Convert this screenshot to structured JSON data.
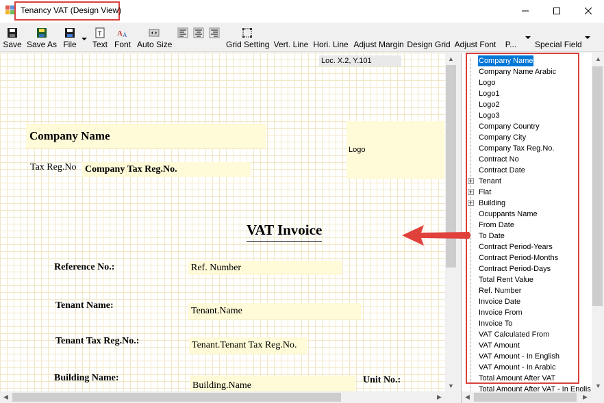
{
  "window": {
    "title": "Tenancy VAT (Design View)",
    "controls": [
      "minimize",
      "maximize",
      "close"
    ]
  },
  "toolbar": {
    "buttons": [
      {
        "label": "Save",
        "icon": "floppy-disk-icon"
      },
      {
        "label": "Save As",
        "icon": "save-as-icon"
      },
      {
        "label": "File",
        "icon": "file-floppy-icon"
      },
      {
        "label": "Text",
        "icon": "text-icon"
      },
      {
        "label": "Font",
        "icon": "font-icon"
      },
      {
        "label": "Auto Size",
        "icon": "auto-size-icon"
      },
      {
        "label": "Grid Setting",
        "icon": "grid-setting-icon"
      },
      {
        "label": "Vert. Line",
        "icon": ""
      },
      {
        "label": "Hori. Line",
        "icon": ""
      },
      {
        "label": "Adjust Margin",
        "icon": ""
      },
      {
        "label": "Design Grid",
        "icon": ""
      },
      {
        "label": "Adjust Font",
        "icon": ""
      },
      {
        "label": "P...",
        "icon": ""
      },
      {
        "label": "Special Field",
        "icon": ""
      }
    ]
  },
  "canvas": {
    "location_readout": "Loc. X.2, Y.101",
    "company_name": "Company Name",
    "logo": "Logo",
    "tax_reg_label": "Tax Reg.No",
    "company_tax_reg": "Company Tax Reg.No.",
    "invoice_title": "VAT Invoice",
    "reference_label": "Reference No.:",
    "reference_value": "Ref. Number",
    "tenant_name_label": "Tenant Name:",
    "tenant_name_value": "Tenant.Name",
    "tenant_tax_label": "Tenant Tax Reg.No.:",
    "tenant_tax_value": "Tenant.Tenant Tax Reg.No.",
    "building_label": "Building Name:",
    "building_value": "Building.Name",
    "unit_label": "Unit No.:"
  },
  "field_tree": {
    "items": [
      {
        "label": "Company Name",
        "selected": true,
        "expandable": false
      },
      {
        "label": "Company Name Arabic",
        "expandable": false
      },
      {
        "label": "Logo",
        "expandable": false
      },
      {
        "label": "Logo1",
        "expandable": false
      },
      {
        "label": "Logo2",
        "expandable": false
      },
      {
        "label": "Logo3",
        "expandable": false
      },
      {
        "label": "Company Country",
        "expandable": false
      },
      {
        "label": "Company City",
        "expandable": false
      },
      {
        "label": "Company Tax Reg.No.",
        "expandable": false
      },
      {
        "label": "Contract No",
        "expandable": false
      },
      {
        "label": "Contract Date",
        "expandable": false
      },
      {
        "label": "Tenant",
        "expandable": true
      },
      {
        "label": "Flat",
        "expandable": true
      },
      {
        "label": "Building",
        "expandable": true
      },
      {
        "label": "Ocuppants Name",
        "expandable": false
      },
      {
        "label": "From Date",
        "expandable": false
      },
      {
        "label": "To Date",
        "expandable": false
      },
      {
        "label": "Contract Period-Years",
        "expandable": false
      },
      {
        "label": "Contract Period-Months",
        "expandable": false
      },
      {
        "label": "Contract Period-Days",
        "expandable": false
      },
      {
        "label": "Total Rent Value",
        "expandable": false
      },
      {
        "label": "Ref. Number",
        "expandable": false
      },
      {
        "label": "Invoice Date",
        "expandable": false
      },
      {
        "label": "Invoice From",
        "expandable": false
      },
      {
        "label": "Invoice To",
        "expandable": false
      },
      {
        "label": "VAT Calculated From",
        "expandable": false
      },
      {
        "label": "VAT Amount",
        "expandable": false
      },
      {
        "label": "VAT Amount - In English",
        "expandable": false
      },
      {
        "label": "VAT Amount - In Arabic",
        "expandable": false
      },
      {
        "label": "Total Amount After VAT",
        "expandable": false
      },
      {
        "label": "Total Amount After VAT - In Englis",
        "expandable": false
      }
    ]
  },
  "colors": {
    "highlight_red": "#d9413e",
    "selection_blue": "#0078d7",
    "field_fill": "#fffad7",
    "grid_line": "#f1e7c6"
  }
}
